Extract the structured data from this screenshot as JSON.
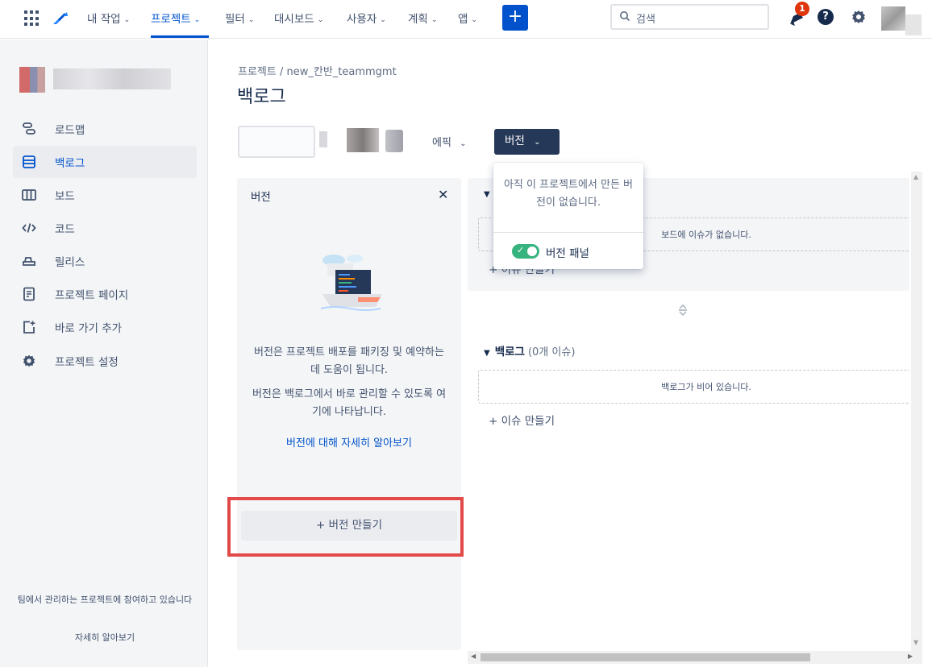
{
  "topnav": {
    "items": [
      {
        "label": "내 작업",
        "active": false
      },
      {
        "label": "프로젝트",
        "active": true
      },
      {
        "label": "필터",
        "active": false
      },
      {
        "label": "대시보드",
        "active": false
      },
      {
        "label": "사용자",
        "active": false
      },
      {
        "label": "계획",
        "active": false
      },
      {
        "label": "앱",
        "active": false
      }
    ],
    "create_label": "+",
    "search_placeholder": "검색",
    "notification_count": "1",
    "help_label": "?",
    "accent_color": "#0052cc"
  },
  "sidebar": {
    "items": [
      {
        "label": "로드맵",
        "icon": "roadmap-icon"
      },
      {
        "label": "백로그",
        "icon": "backlog-icon",
        "active": true
      },
      {
        "label": "보드",
        "icon": "board-icon"
      },
      {
        "label": "코드",
        "icon": "code-icon"
      },
      {
        "label": "릴리스",
        "icon": "release-icon"
      },
      {
        "label": "프로젝트 페이지",
        "icon": "page-icon"
      },
      {
        "label": "바로 가기 추가",
        "icon": "add-shortcut-icon"
      },
      {
        "label": "프로젝트 설정",
        "icon": "gear-icon"
      }
    ],
    "footer_text": "팀에서 관리하는 프로젝트에 참여하고 있습니다",
    "footer_link": "자세히 알아보기"
  },
  "main": {
    "breadcrumb": "프로젝트  /  new_칸반_teammgmt",
    "title": "백로그",
    "epic_label": "에픽",
    "version_label": "버전"
  },
  "version_panel": {
    "title": "버전",
    "close": "✕",
    "text1": "버전은 프로젝트 배포를 패키징 및 예약하는 데 도움이 됩니다.",
    "text2": "버전은 백로그에서 바로 관리할 수 있도록 여기에 나타납니다.",
    "link": "버전에 대해 자세히 알아보기",
    "create": "+ 버전 만들기"
  },
  "sprint": {
    "empty_text": "보드에 이슈가 없습니다.",
    "create": "+ 이슈 만들기"
  },
  "backlog": {
    "title": "백로그",
    "count": "(0개 이슈)",
    "empty_text": "백로그가 비어 있습니다.",
    "create": "+ 이슈 만들기"
  },
  "dropdown": {
    "text": "아직 이 프로젝트에서 만든 버전이 없습니다.",
    "toggle_label": "버전 패널",
    "toggle_on": true
  }
}
